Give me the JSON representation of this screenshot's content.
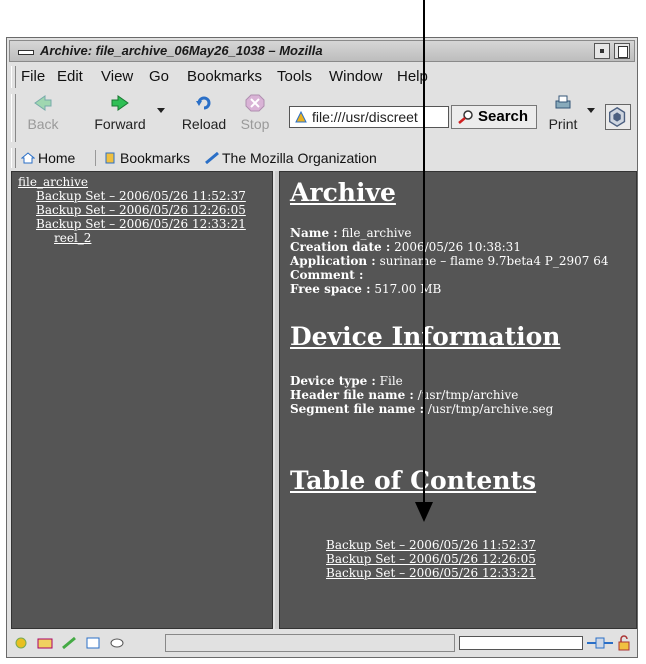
{
  "window": {
    "title": "Archive: file_archive_06May26_1038 – Mozilla"
  },
  "menubar": {
    "items": [
      "File",
      "Edit",
      "View",
      "Go",
      "Bookmarks",
      "Tools",
      "Window",
      "Help"
    ]
  },
  "toolbar": {
    "back": "Back",
    "forward": "Forward",
    "reload": "Reload",
    "stop": "Stop",
    "url": "file:///usr/discreet",
    "search": "Search",
    "print": "Print"
  },
  "personal_toolbar": {
    "home": "Home",
    "bookmarks": "Bookmarks",
    "mozilla_org": "The Mozilla Organization"
  },
  "left_pane": {
    "root": "file_archive",
    "sets": [
      "Backup Set – 2006/05/26 11:52:37",
      "Backup Set – 2006/05/26 12:26:05",
      "Backup Set – 2006/05/26 12:33:21"
    ],
    "reel": "reel_2"
  },
  "right_pane": {
    "archive_heading": "Archive",
    "name_label": "Name :",
    "name_value": "file_archive",
    "creation_label": "Creation date :",
    "creation_value": "2006/05/26 10:38:31",
    "application_label": "Application :",
    "application_value": "suriname – flame 9.7beta4 P_2907 64",
    "comment_label": "Comment :",
    "free_space_label": "Free space :",
    "free_space_value": "517.00 MB",
    "device_heading": "Device Information",
    "device_type_label": "Device type :",
    "device_type_value": "File",
    "header_file_label": "Header file name :",
    "header_file_value": "/usr/tmp/archive",
    "segment_file_label": "Segment file name :",
    "segment_file_value": "/usr/tmp/archive.seg",
    "toc_heading": "Table of Contents",
    "toc": [
      "Backup Set – 2006/05/26 11:52:37",
      "Backup Set – 2006/05/26 12:26:05",
      "Backup Set – 2006/05/26 12:33:21"
    ]
  },
  "colors": {
    "pane_bg": "#555555",
    "chrome_bg": "#e1e1e1",
    "link": "#ffffff",
    "arrow": "#000000"
  }
}
